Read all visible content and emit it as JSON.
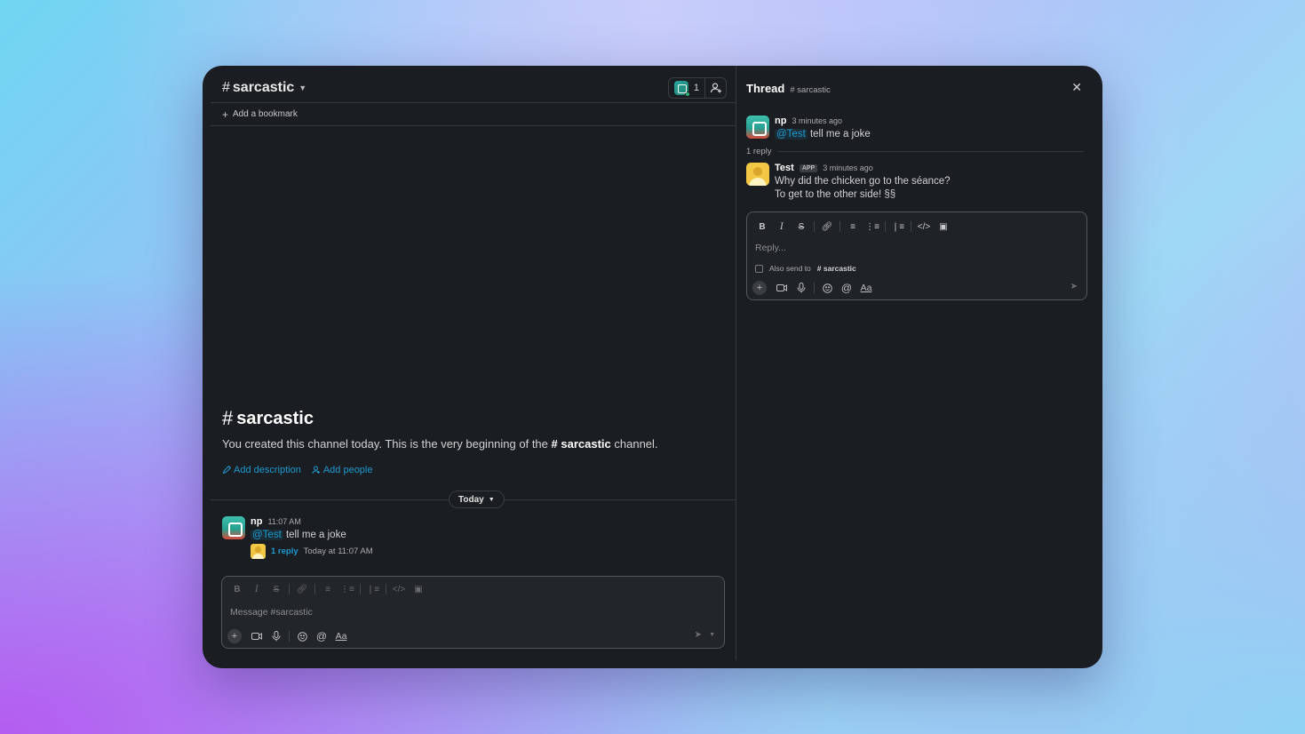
{
  "channel": {
    "name": "sarcastic",
    "member_count": "1",
    "bookmark_label": "Add a bookmark",
    "intro_title": "sarcastic",
    "intro_text_before": "You created this channel today. This is the very beginning of the",
    "intro_channel": "sarcastic",
    "intro_text_after": "channel.",
    "add_description": "Add description",
    "add_people": "Add people",
    "date_divider": "Today"
  },
  "message": {
    "author": "np",
    "time": "11:07 AM",
    "mention": "@Test",
    "text": "tell me a joke",
    "reply_count": "1 reply",
    "reply_last": "Today at 11:07 AM"
  },
  "composer": {
    "placeholder": "Message #sarcastic",
    "format_label": "Aa"
  },
  "thread": {
    "title": "Thread",
    "channel": "# sarcastic",
    "root": {
      "author": "np",
      "time": "3 minutes ago",
      "mention": "@Test",
      "text": "tell me a joke"
    },
    "replies_label": "1 reply",
    "reply": {
      "author": "Test",
      "badge": "APP",
      "time": "3 minutes ago",
      "line1": "Why did the chicken go to the séance?",
      "line2": "To get to the other side! §§"
    },
    "composer": {
      "placeholder": "Reply...",
      "also_send": "Also send to",
      "also_send_channel": "# sarcastic",
      "format_label": "Aa"
    }
  },
  "colors": {
    "window_bg": "#1a1d21",
    "link": "#1d9bd1",
    "border": "#34373b"
  }
}
